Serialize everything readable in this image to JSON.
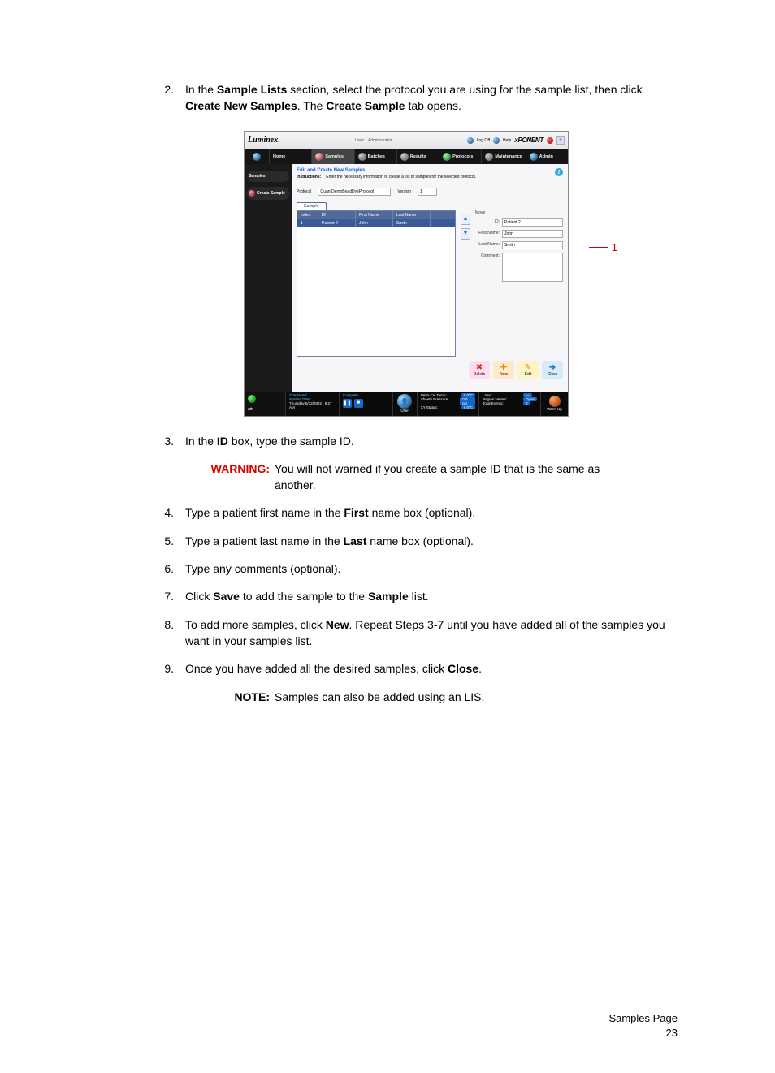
{
  "steps": {
    "s2_a": "In the ",
    "s2_b": "Sample Lists",
    "s2_c": " section, select the protocol you are using for the sample list, then click ",
    "s2_d": "Create New Samples",
    "s2_e": ". The ",
    "s2_f": "Create Sample",
    "s2_g": " tab opens.",
    "s3_a": "In the ",
    "s3_b": "ID",
    "s3_c": " box, type the sample ID.",
    "s4_a": "Type a patient first name in the ",
    "s4_b": "First",
    "s4_c": " name box (optional).",
    "s5_a": "Type a patient last name in the ",
    "s5_b": "Last",
    "s5_c": " name box (optional).",
    "s6": "Type any comments (optional).",
    "s7_a": "Click ",
    "s7_b": "Save",
    "s7_c": " to add the sample to the ",
    "s7_d": "Sample",
    "s7_e": " list.",
    "s8_a": "To add more samples, click ",
    "s8_b": "New",
    "s8_c": ". Repeat Steps 3-7 until you have added all of the samples you want in your samples list.",
    "s9_a": "Once you have added all the desired samples, click ",
    "s9_b": "Close",
    "s9_c": "."
  },
  "warning": {
    "label": "WARNING:",
    "text": "You will not warned if you create a sample ID that is the same as another."
  },
  "note": {
    "label": "NOTE:",
    "text": "Samples can also be added using an LIS."
  },
  "footer": {
    "title": "Samples Page",
    "page": "23"
  },
  "callout": "1",
  "screenshot": {
    "brand_a": "Luminex",
    "brand_dot": ".",
    "user_label": "User:",
    "user_value": "Administrator",
    "logoff": "Log Off",
    "help": "Help",
    "product": "xPONENT",
    "nav": {
      "home": "Home",
      "samples": "Samples",
      "batches": "Batches",
      "results": "Results",
      "protocols": "Protocols",
      "maintenance": "Maintenance",
      "admin": "Admin"
    },
    "side": {
      "samples": "Samples",
      "create": "Create Sample"
    },
    "main": {
      "title": "Edit and Create New Samples",
      "instr_label": "Instructions:",
      "instr_text": "Enter the necessary information to create a list of samples for the selected protocol.",
      "protocol_label": "Protocol",
      "protocol_value": "QuantDemoBeadDyeProtocol",
      "version_label": "Version",
      "version_value": "1",
      "sample_tab": "Sample",
      "grid": {
        "h_index": "Index",
        "h_id": "ID",
        "h_fn": "First Name",
        "h_ln": "Last Name",
        "r_index": "1",
        "r_id": "Patient 2",
        "r_fn": "John",
        "r_ln": "Smith"
      },
      "form": {
        "move": "Move",
        "id_label": "ID:",
        "id_val": "Patient 2",
        "fn_label": "First Name:",
        "fn_val": "John",
        "ln_label": "Last Name:",
        "ln_val": "Smith",
        "cm_label": "Comment:"
      },
      "actions": {
        "delete": "Delete",
        "new": "New",
        "edit": "Edit",
        "close": "Close"
      }
    },
    "status": {
      "command": "Command:",
      "complete": "Complete",
      "sysdate": "System Date:",
      "date": "Thursday 5/12/2022",
      "time": "9:27 AM",
      "user_lbl": "User",
      "dcal": "Delta Cal Temp:",
      "dcal_v": "0.0°C",
      "sheath": "Sheath Pressure:",
      "sheath_v": "0.0 psi",
      "xys": "XY Status:",
      "xys_v": "0.0°C",
      "laser": "Laser:",
      "rheat": "Region Heater:",
      "rheat_v": "Open",
      "tevents": "Total Events:",
      "tevents_v": "0",
      "warmup": "Warm Up"
    }
  }
}
